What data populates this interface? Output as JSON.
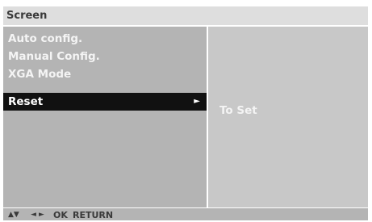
{
  "window": {
    "title": "Screen"
  },
  "menu": {
    "items": [
      {
        "label": "Auto config.",
        "selected": false
      },
      {
        "label": "Manual Config.",
        "selected": false
      },
      {
        "label": "XGA Mode",
        "selected": false
      },
      {
        "label": "Reset",
        "selected": true,
        "arrow_icon": "triangle-right-icon"
      }
    ]
  },
  "submenu": {
    "option_label": "To Set"
  },
  "footer": {
    "nav_updown": "▲▼",
    "nav_leftright": "◄ ►",
    "ok": "OK",
    "return": "RETURN"
  },
  "colors": {
    "title_bar_bg": "#dedede",
    "left_panel_bg": "#b4b4b4",
    "right_panel_bg": "#c8c8c8",
    "selected_bg": "#111111",
    "text_light": "#f4f4f4",
    "text_dark": "#3a3a3a"
  }
}
